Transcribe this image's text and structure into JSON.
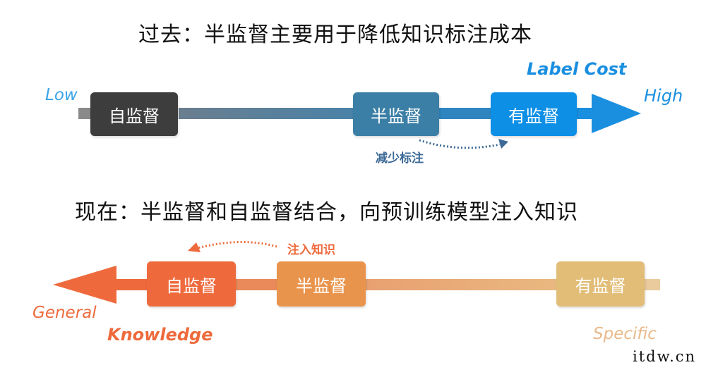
{
  "past": {
    "title": "过去：半监督主要用于降低知识标注成本",
    "axis_label": "Label Cost",
    "low_label": "Low",
    "high_label": "High",
    "boxes": [
      {
        "label": "自监督",
        "color": "#3d3d3d"
      },
      {
        "label": "半监督",
        "color": "#3c7fa6"
      },
      {
        "label": "有监督",
        "color": "#0d8fe6"
      }
    ],
    "annotation": "减少标注",
    "colors": {
      "accent": "#1a8fe0",
      "annotation": "#3d6a96",
      "low": "#3aa4e8"
    }
  },
  "present": {
    "title": "现在：半监督和自监督结合，向预训练模型注入知识",
    "general_label": "General",
    "knowledge_label": "Knowledge",
    "specific_label": "Specific",
    "boxes": [
      {
        "label": "自监督",
        "color": "#ee6a3c"
      },
      {
        "label": "半监督",
        "color": "#e9944c"
      },
      {
        "label": "有监督",
        "color": "#e2bd78"
      }
    ],
    "annotation": "注入知识",
    "colors": {
      "accent": "#ee6a3c",
      "specific": "#e8b98a"
    }
  },
  "watermark": "itdw.cn"
}
